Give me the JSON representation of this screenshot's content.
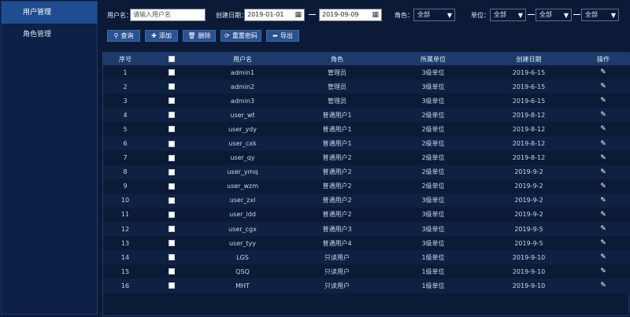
{
  "sidebar": {
    "items": [
      {
        "label": "用户管理",
        "active": true
      },
      {
        "label": "角色管理",
        "active": false
      }
    ]
  },
  "filters": {
    "username_label": "用户名：",
    "username_placeholder": "请输入用户名",
    "date_label": "创建日期：",
    "date_start": "2019-01-01",
    "date_end": "2019-09-09",
    "role_label": "角色：",
    "role_value": "全部",
    "unit_label": "单位：",
    "unit_values": [
      "全部",
      "全部",
      "全部"
    ]
  },
  "toolbar": {
    "query": "查询",
    "add": "添加",
    "delete": "删除",
    "reset_password": "重置密码",
    "export": "导出"
  },
  "table": {
    "headers": [
      "序号",
      "",
      "用户名",
      "角色",
      "所属单位",
      "创建日期",
      "操作"
    ],
    "rows": [
      {
        "no": "1",
        "username": "admin1",
        "role": "管理员",
        "unit": "3级单位",
        "date": "2019-6-15"
      },
      {
        "no": "2",
        "username": "admin2",
        "role": "管理员",
        "unit": "3级单位",
        "date": "2019-6-15"
      },
      {
        "no": "3",
        "username": "admin3",
        "role": "管理员",
        "unit": "3级单位",
        "date": "2019-6-15"
      },
      {
        "no": "4",
        "username": "user_wt",
        "role": "普通用户1",
        "unit": "2级单位",
        "date": "2019-8-12"
      },
      {
        "no": "5",
        "username": "user_ydy",
        "role": "普通用户1",
        "unit": "2级单位",
        "date": "2019-8-12"
      },
      {
        "no": "6",
        "username": "user_cxk",
        "role": "普通用户1",
        "unit": "2级单位",
        "date": "2019-8-12"
      },
      {
        "no": "7",
        "username": "user_qy",
        "role": "普通用户2",
        "unit": "2级单位",
        "date": "2019-8-12"
      },
      {
        "no": "8",
        "username": "user_ymq",
        "role": "普通用户2",
        "unit": "2级单位",
        "date": "2019-9-2"
      },
      {
        "no": "9",
        "username": "user_wzm",
        "role": "普通用户2",
        "unit": "2级单位",
        "date": "2019-9-2"
      },
      {
        "no": "10",
        "username": "user_zxl",
        "role": "普通用户2",
        "unit": "3级单位",
        "date": "2019-9-2"
      },
      {
        "no": "11",
        "username": "user_ldd",
        "role": "普通用户2",
        "unit": "3级单位",
        "date": "2019-9-2"
      },
      {
        "no": "12",
        "username": "user_cgx",
        "role": "普通用户3",
        "unit": "3级单位",
        "date": "2019-9-5"
      },
      {
        "no": "13",
        "username": "user_tyy",
        "role": "普通用户4",
        "unit": "3级单位",
        "date": "2019-9-5"
      },
      {
        "no": "14",
        "username": "LGS",
        "role": "只读用户",
        "unit": "1级单位",
        "date": "2019-9-10"
      },
      {
        "no": "15",
        "username": "QSQ",
        "role": "只读用户",
        "unit": "1级单位",
        "date": "2019-9-10"
      },
      {
        "no": "16",
        "username": "MHT",
        "role": "只读用户",
        "unit": "1级单位",
        "date": "2019-9-10"
      }
    ]
  },
  "icons": {
    "search": "search-icon",
    "add": "plus-icon",
    "delete": "trash-icon",
    "reset": "refresh-icon",
    "export": "share-icon",
    "edit": "pencil-icon",
    "calendar": "calendar-icon"
  },
  "colors": {
    "background": "#0b1a36",
    "sidebar_active": "#1f4d92",
    "button": "#2a5191",
    "header_row": "#1c3b6b"
  }
}
